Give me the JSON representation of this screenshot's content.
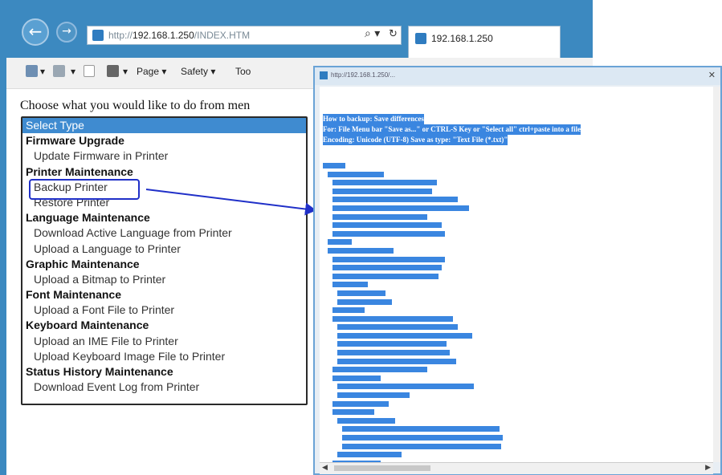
{
  "browser": {
    "url_prefix": "http://",
    "url_host": "192.168.1.250",
    "url_path": "/INDEX.HTM",
    "tab_title": "192.168.1.250",
    "back_icon": "back-arrow-icon",
    "forward_icon": "forward-arrow-icon",
    "accent": "#3c89c0"
  },
  "toolbar": {
    "page_label": "Page ▾",
    "safety_label": "Safety ▾",
    "tools_label": "Too"
  },
  "page": {
    "prompt": "Choose what you would like to do from men"
  },
  "listbox": {
    "options": [
      {
        "kind": "selected",
        "label": "Select Type"
      },
      {
        "kind": "group",
        "label": "Firmware Upgrade"
      },
      {
        "kind": "item",
        "label": "Update Firmware in Printer"
      },
      {
        "kind": "group",
        "label": "Printer Maintenance"
      },
      {
        "kind": "item",
        "label": "Backup Printer"
      },
      {
        "kind": "item",
        "label": "Restore Printer"
      },
      {
        "kind": "group",
        "label": "Language Maintenance"
      },
      {
        "kind": "item",
        "label": "Download Active Language from Printer"
      },
      {
        "kind": "item",
        "label": "Upload a Language to Printer"
      },
      {
        "kind": "group",
        "label": "Graphic Maintenance"
      },
      {
        "kind": "item",
        "label": "Upload a Bitmap to Printer"
      },
      {
        "kind": "group",
        "label": "Font Maintenance"
      },
      {
        "kind": "item",
        "label": "Upload a Font File to Printer"
      },
      {
        "kind": "group",
        "label": "Keyboard Maintenance"
      },
      {
        "kind": "item",
        "label": "Upload an IME File to Printer"
      },
      {
        "kind": "item",
        "label": "Upload Keyboard Image File to Printer"
      },
      {
        "kind": "group",
        "label": "Status History Maintenance"
      },
      {
        "kind": "item",
        "label": "Download Event Log from Printer"
      }
    ],
    "selected_color": "#3f8bd0",
    "callout_color": "#2030c8"
  },
  "popup": {
    "title": "http://192.168.1.250/...",
    "selection_color": "#3a86e0",
    "instructions": [
      "How to backup: Save differences",
      "For: File Menu bar \"Save as...\" or CTRL-S Key or \"Select all\" ctrl+paste into a file",
      "Encoding: Unicode (UTF-8) Save as type: \"Text File (*.txt)\""
    ]
  }
}
